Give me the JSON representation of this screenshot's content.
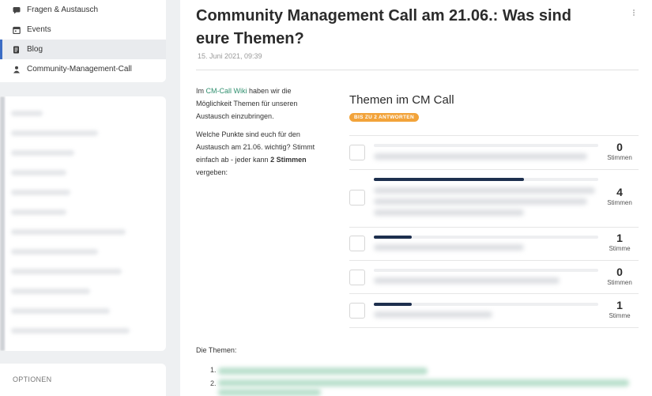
{
  "sidebar": {
    "items": [
      {
        "label": "Fragen & Austausch",
        "icon": "chat-icon",
        "active": false
      },
      {
        "label": "Events",
        "icon": "calendar-icon",
        "active": false
      },
      {
        "label": "Blog",
        "icon": "blog-icon",
        "active": true
      },
      {
        "label": "Community-Management-Call",
        "icon": "group-icon",
        "active": false
      }
    ],
    "options_label": "OPTIONEN"
  },
  "post": {
    "title": "Community Management Call am 21.06.: Was sind eure Themen?",
    "date": "15. Juni 2021, 09:39",
    "intro_prefix": "Im ",
    "intro_link": "CM-Call Wiki",
    "intro_suffix": " haben wir die Möglichkeit Themen für unseren Austausch einzubringen.",
    "question_prefix": "Welche Punkte sind euch für den Austausch am 21.06. wichtig? Stimmt einfach ab - jeder kann ",
    "question_bold": "2 Stimmen",
    "question_suffix": " vergeben:",
    "topics_label": "Die Themen:",
    "list_numbers": [
      "1.",
      "2."
    ]
  },
  "poll": {
    "title": "Themen im CM Call",
    "badge": "BIS ZU 2 ANTWORTEN",
    "options": [
      {
        "count": "0",
        "unit": "Stimmen",
        "fraction": 0
      },
      {
        "count": "4",
        "unit": "Stimmen",
        "fraction": 0.67
      },
      {
        "count": "1",
        "unit": "Stimme",
        "fraction": 0.17
      },
      {
        "count": "0",
        "unit": "Stimmen",
        "fraction": 0
      },
      {
        "count": "1",
        "unit": "Stimme",
        "fraction": 0.17
      }
    ]
  },
  "colors": {
    "accent": "#3b6cc4",
    "badge": "#f2a33a",
    "bar": "#1d2f4e",
    "link": "#2f8f6e"
  }
}
